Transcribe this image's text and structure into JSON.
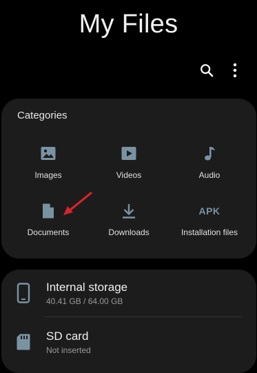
{
  "header": {
    "title": "My Files"
  },
  "toolbar": {
    "search_icon": "search-icon",
    "more_icon": "more-vertical-icon"
  },
  "categories": {
    "label": "Categories",
    "items": [
      {
        "label": "Images",
        "icon": "image-icon"
      },
      {
        "label": "Videos",
        "icon": "video-icon"
      },
      {
        "label": "Audio",
        "icon": "music-note-icon"
      },
      {
        "label": "Documents",
        "icon": "document-icon"
      },
      {
        "label": "Downloads",
        "icon": "download-icon"
      },
      {
        "label": "Installation files",
        "icon": "apk-icon",
        "icon_text": "APK"
      }
    ]
  },
  "storage": {
    "items": [
      {
        "title": "Internal storage",
        "subtitle": "40.41 GB / 64.00 GB",
        "icon": "phone-storage-icon"
      },
      {
        "title": "SD card",
        "subtitle": "Not inserted",
        "icon": "sd-card-icon"
      }
    ]
  },
  "colors": {
    "background": "#000000",
    "card": "#1c1c1c",
    "icon_accent": "#7a93a3",
    "annotation_arrow": "#d8232a"
  }
}
